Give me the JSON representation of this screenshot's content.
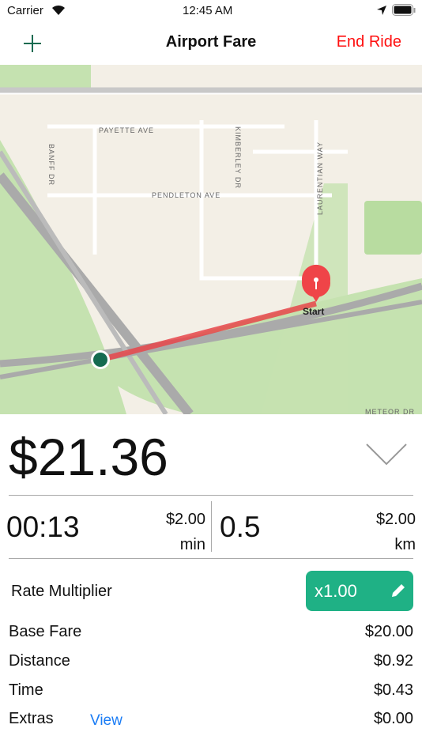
{
  "status": {
    "carrier": "Carrier",
    "time": "12:45 AM"
  },
  "nav": {
    "title": "Airport Fare",
    "end_ride": "End Ride",
    "add_icon": "plus-icon"
  },
  "map": {
    "streets": [
      "PAYETTE AVE",
      "PENDLETON AVE",
      "BANFF DR",
      "KIMBERLEY DR",
      "LAURENTIAN WAY",
      "METEOR DR"
    ],
    "start_label": "Start",
    "route_color": "#e8474b"
  },
  "fare": {
    "total": "$21.36"
  },
  "meters": {
    "time": "00:13",
    "time_rate": "$2.00",
    "time_unit": "min",
    "distance": "0.5",
    "distance_rate": "$2.00",
    "distance_unit": "km"
  },
  "multiplier": {
    "label": "Rate Multiplier",
    "value": "x1.00",
    "color": "#1fb185"
  },
  "breakdown": [
    {
      "label": "Base Fare",
      "value": "$20.00"
    },
    {
      "label": "Distance",
      "value": "$0.92"
    },
    {
      "label": "Time",
      "value": "$0.43"
    },
    {
      "label": "Extras",
      "value": "$0.00",
      "link": "View"
    }
  ]
}
